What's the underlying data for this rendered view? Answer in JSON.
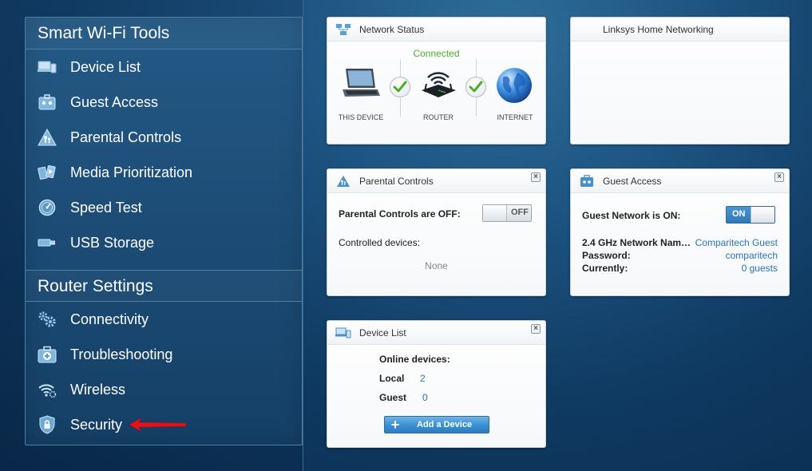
{
  "sidebar": {
    "tools_title": "Smart Wi-Fi Tools",
    "tools": [
      {
        "label": "Device List",
        "icon": "device-list-icon"
      },
      {
        "label": "Guest Access",
        "icon": "guest-access-icon"
      },
      {
        "label": "Parental Controls",
        "icon": "parental-controls-icon"
      },
      {
        "label": "Media Prioritization",
        "icon": "media-prioritization-icon"
      },
      {
        "label": "Speed Test",
        "icon": "speed-test-icon"
      },
      {
        "label": "USB Storage",
        "icon": "usb-storage-icon"
      }
    ],
    "router_title": "Router Settings",
    "router": [
      {
        "label": "Connectivity",
        "icon": "gears-icon"
      },
      {
        "label": "Troubleshooting",
        "icon": "first-aid-icon"
      },
      {
        "label": "Wireless",
        "icon": "wireless-icon"
      },
      {
        "label": "Security",
        "icon": "shield-lock-icon"
      }
    ]
  },
  "widgets": {
    "network_status": {
      "title": "Network Status",
      "status": "Connected",
      "this_device": "THIS DEVICE",
      "router": "ROUTER",
      "internet": "INTERNET"
    },
    "linksys": {
      "title": "Linksys Home Networking"
    },
    "parental_controls": {
      "title": "Parental Controls",
      "status_label": "Parental Controls are OFF:",
      "toggle": "OFF",
      "controlled_label": "Controlled devices:",
      "controlled_value": "None"
    },
    "guest_access": {
      "title": "Guest Access",
      "status_label": "Guest Network is ON:",
      "toggle": "ON",
      "network_label": "2.4 GHz Network Nam…",
      "network_value": "Comparitech Guest",
      "password_label": "Password:",
      "password_value": "comparitech",
      "currently_label": "Currently:",
      "currently_value": "0 guests"
    },
    "device_list": {
      "title": "Device List",
      "online_label": "Online devices:",
      "local_label": "Local",
      "local_value": "2",
      "guest_label": "Guest",
      "guest_value": "0",
      "add_label": "Add a Device"
    }
  },
  "colors": {
    "accent_blue": "#2b74b4",
    "connected_green": "#4caf2a",
    "arrow_red": "#e0141e"
  }
}
